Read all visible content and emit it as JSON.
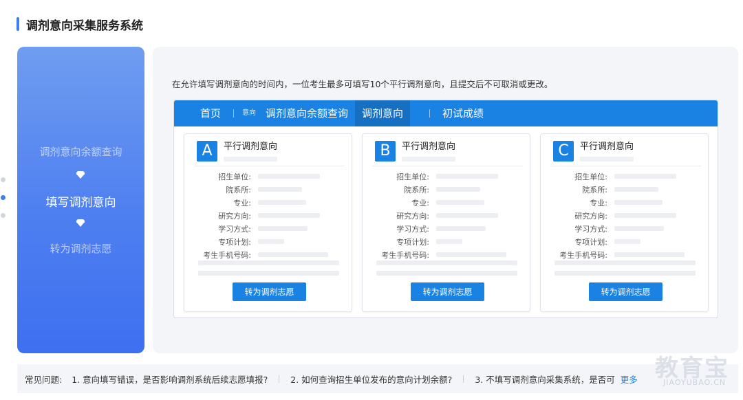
{
  "header": {
    "title": "调剂意向采集服务系统"
  },
  "steps": [
    {
      "label": "调剂意向余额查询",
      "current": false
    },
    {
      "label": "填写调剂意向",
      "current": true
    },
    {
      "label": "转为调剂志愿",
      "current": false
    }
  ],
  "notice": "在允许填写调剂意向的时间内，一位考生最多可填写10个平行调剂意向，且提交后不可取消或更改。",
  "nav": {
    "home": "首页",
    "small": "意向",
    "quota_query": "调剂意向余额查询",
    "intent": "调剂意向",
    "scores": "初试成绩"
  },
  "cards": [
    {
      "letter": "A",
      "title": "平行调剂意向",
      "button": "转为调剂志愿"
    },
    {
      "letter": "B",
      "title": "平行调剂意向",
      "button": "转为调剂志愿"
    },
    {
      "letter": "C",
      "title": "平行调剂意向",
      "button": "转为调剂志愿"
    }
  ],
  "field_labels": {
    "unit": "招生单位:",
    "dept": "院系所:",
    "major": "专业:",
    "direction": "研究方向:",
    "study_mode": "学习方式:",
    "special_plan": "专项计划:",
    "phone": "考生手机号码:"
  },
  "faq": {
    "label": "常见问题:",
    "q1": "1. 意向填写错误，是否影响调剂系统后续志愿填报?",
    "q2": "2. 如何查询招生单位发布的意向计划余额?",
    "q3": "3. 不填写调剂意向采集系统，是否可",
    "more": "更多"
  },
  "watermark": {
    "cn": "教育宝",
    "en": "JIAOYUBAO.CN"
  },
  "colors": {
    "accent": "#1a82e2",
    "panel_gradient_top": "#6f9df0",
    "panel_gradient_bottom": "#3e6ff0"
  }
}
